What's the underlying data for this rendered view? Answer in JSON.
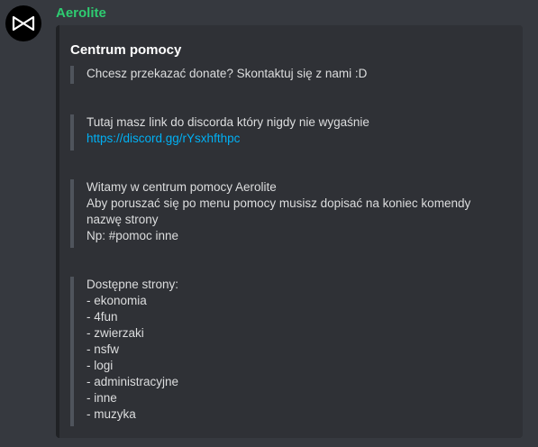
{
  "author": {
    "name": "Aerolite",
    "name_color": "#2ecc71",
    "avatar_icon": "bowtie-logo-icon"
  },
  "embed": {
    "title": "Centrum pomocy",
    "fields": [
      {
        "lines": [
          "Chcesz przekazać donate? Skontaktuj się z nami :D"
        ]
      },
      {
        "text": "Tutaj masz link do discorda który nigdy nie wygaśnie",
        "link": "https://discord.gg/rYsxhfthpc"
      },
      {
        "lines": [
          "Witamy w centrum pomocy Aerolite",
          "Aby poruszać się po menu pomocy musisz dopisać na koniec komendy nazwę strony",
          "Np: #pomoc inne"
        ]
      },
      {
        "lines": [
          "Dostępne strony:",
          "- ekonomia",
          "- 4fun",
          "- zwierzaki",
          "- nsfw",
          "- logi",
          "- administracyjne",
          "- inne",
          "- muzyka"
        ]
      }
    ]
  }
}
